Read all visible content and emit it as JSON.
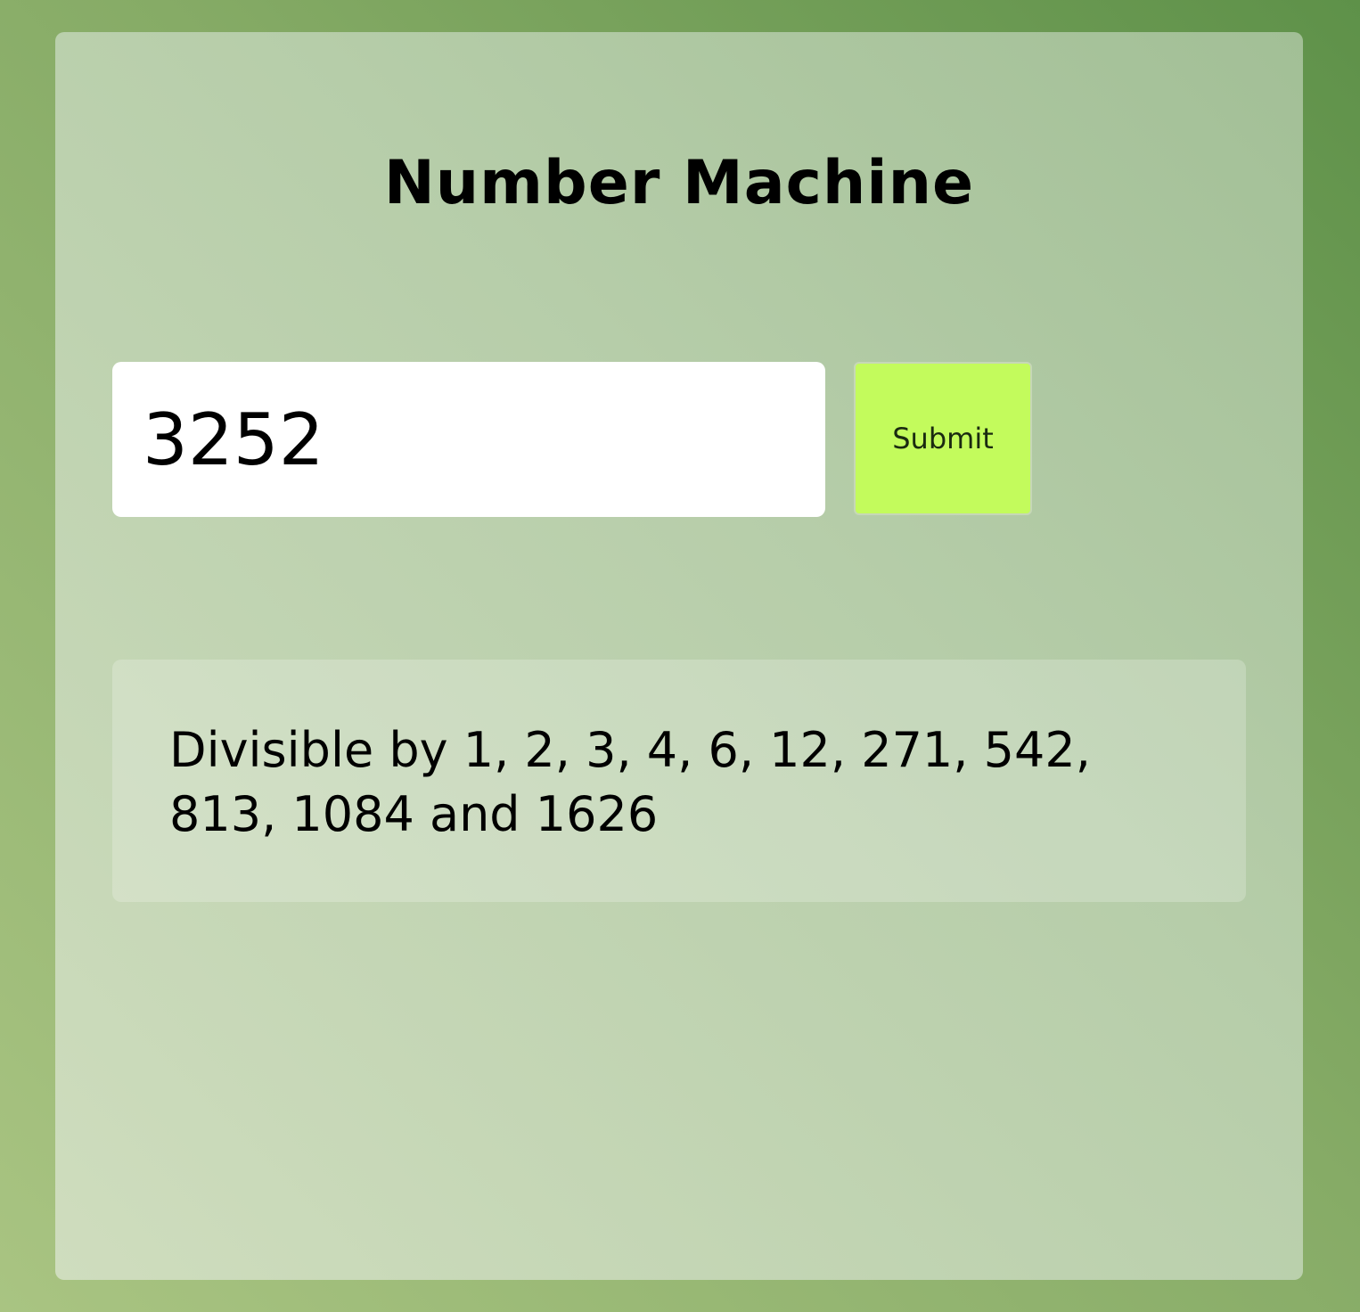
{
  "app": {
    "title": "Number Machine"
  },
  "form": {
    "number_value": "3252",
    "submit_label": "Submit"
  },
  "result": {
    "text": "Divisible by 1, 2, 3, 4, 6, 12, 271, 542, 813, 1084 and 1626"
  },
  "colors": {
    "background": "#7aa35e",
    "card": "#b8cfa8",
    "submit_button": "#c3fb5c",
    "input_background": "#ffffff"
  }
}
